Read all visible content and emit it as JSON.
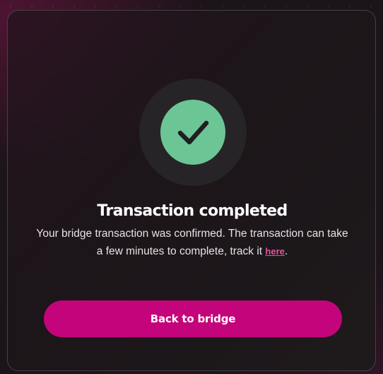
{
  "dialog": {
    "title": "Transaction completed",
    "message_before_link": "Your bridge transaction was confirmed. The transaction can take a few minutes to complete, track it ",
    "link_label": "here",
    "message_after_link": ".",
    "button_label": "Back to bridge",
    "status_icon": "checkmark-icon"
  },
  "colors": {
    "success": "#6cc595",
    "accent": "#c4047a",
    "link": "#e8529d"
  }
}
